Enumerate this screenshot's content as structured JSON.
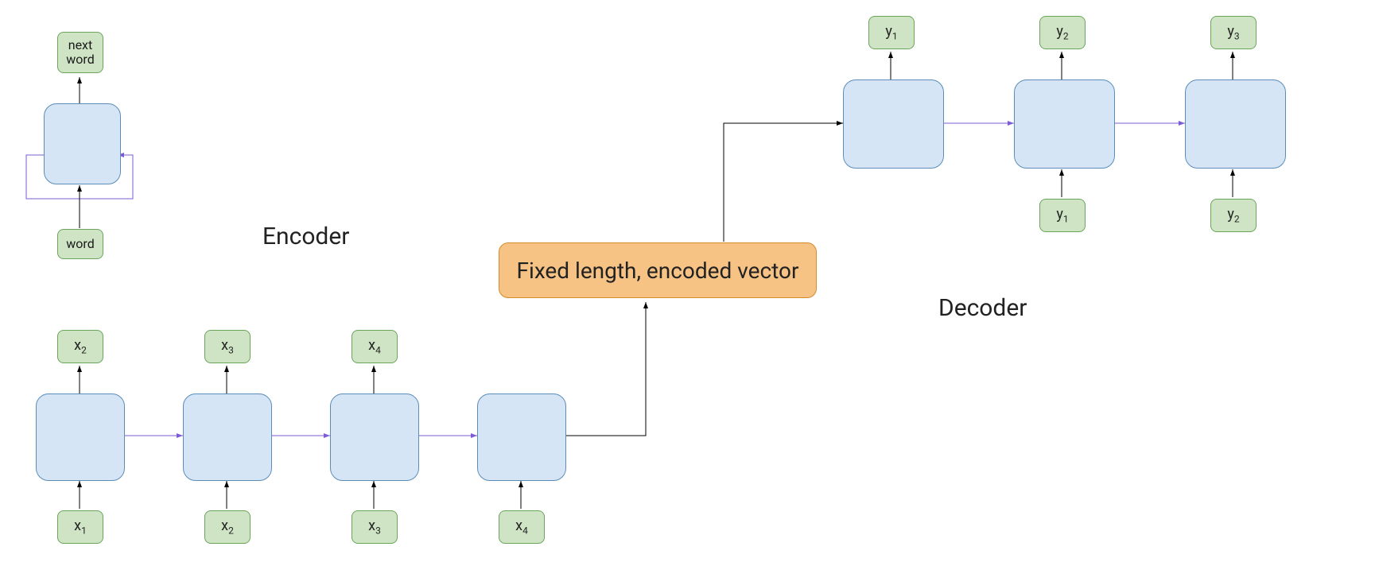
{
  "labels": {
    "encoder": "Encoder",
    "decoder": "Decoder",
    "center": "Fixed length, encoded vector"
  },
  "rnn_mini": {
    "input": "word",
    "output_line1": "next",
    "output_line2": "word"
  },
  "encoder": {
    "inputs": [
      "x",
      "x",
      "x",
      "x"
    ],
    "input_subscripts": [
      "1",
      "2",
      "3",
      "4"
    ],
    "outputs": [
      "x",
      "x",
      "x"
    ],
    "output_subscripts": [
      "2",
      "3",
      "4"
    ]
  },
  "decoder": {
    "outputs": [
      "y",
      "y",
      "y"
    ],
    "output_subscripts": [
      "1",
      "2",
      "3"
    ],
    "inputs": [
      "y",
      "y"
    ],
    "input_subscripts": [
      "1",
      "2"
    ]
  },
  "colors": {
    "blue_fill": "#d6e5f5",
    "blue_stroke": "#5b8db8",
    "green_fill": "#cee4c5",
    "green_stroke": "#6aa55a",
    "orange_fill": "#f7c385",
    "orange_stroke": "#d68a2e",
    "arrow_black": "#000000",
    "arrow_purple": "#7b5cd6"
  }
}
